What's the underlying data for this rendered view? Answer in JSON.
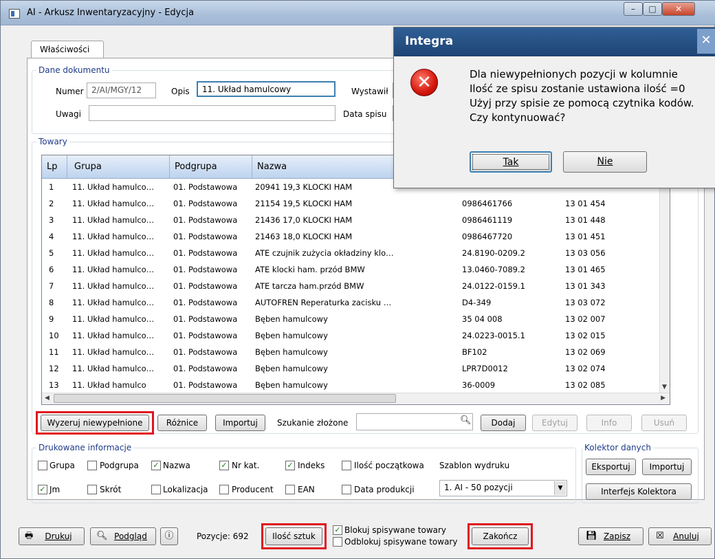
{
  "window": {
    "title": "AI - Arkusz Inwentaryzacyjny - Edycja"
  },
  "tab": "Właściwości",
  "doc": {
    "legend": "Dane dokumentu",
    "numer_label": "Numer",
    "numer": "2/AI/MGY/12",
    "opis_label": "Opis",
    "opis": "11. Układ hamulcowy",
    "wystawil_label": "Wystawił",
    "uwagi_label": "Uwagi",
    "uwagi": "",
    "data_spisu_label": "Data spisu"
  },
  "towary": {
    "legend": "Towary",
    "columns": [
      "Lp",
      "Grupa",
      "Podgrupa",
      "Nazwa"
    ],
    "rows": [
      {
        "lp": "1",
        "grupa": "11. Układ hamulco…",
        "podgrupa": "01. Podstawowa",
        "nazwa": "20941 19,3 KLOCKI HAM",
        "nr": "",
        "indeks": ""
      },
      {
        "lp": "2",
        "grupa": "11. Układ hamulco…",
        "podgrupa": "01. Podstawowa",
        "nazwa": "21154 19,5 KLOCKI HAM",
        "nr": "0986461766",
        "indeks": "13 01 454"
      },
      {
        "lp": "3",
        "grupa": "11. Układ hamulco…",
        "podgrupa": "01. Podstawowa",
        "nazwa": "21436 17,0 KLOCKI HAM",
        "nr": "0986461119",
        "indeks": "13 01 448"
      },
      {
        "lp": "4",
        "grupa": "11. Układ hamulco…",
        "podgrupa": "01. Podstawowa",
        "nazwa": "21463 18,0 KLOCKI HAM",
        "nr": "0986467720",
        "indeks": "13 01 451"
      },
      {
        "lp": "5",
        "grupa": "11. Układ hamulco…",
        "podgrupa": "01. Podstawowa",
        "nazwa": "ATE czujnik zużycia okładziny klo…",
        "nr": "24.8190-0209.2",
        "indeks": "13 03 056"
      },
      {
        "lp": "6",
        "grupa": "11. Układ hamulco…",
        "podgrupa": "01. Podstawowa",
        "nazwa": "ATE klocki ham. przód BMW",
        "nr": "13.0460-7089.2",
        "indeks": "13 01 465"
      },
      {
        "lp": "7",
        "grupa": "11. Układ hamulco…",
        "podgrupa": "01. Podstawowa",
        "nazwa": "ATE tarcza ham.przód BMW",
        "nr": "24.0122-0159.1",
        "indeks": "13 01 343"
      },
      {
        "lp": "8",
        "grupa": "11. Układ hamulco…",
        "podgrupa": "01. Podstawowa",
        "nazwa": "AUTOFREN Reperaturka zacisku …",
        "nr": "D4-349",
        "indeks": "13 03 072"
      },
      {
        "lp": "9",
        "grupa": "11. Układ hamulco…",
        "podgrupa": "01. Podstawowa",
        "nazwa": "Bęben hamulcowy",
        "nr": "35 04 008",
        "indeks": "13 02 007"
      },
      {
        "lp": "10",
        "grupa": "11. Układ hamulco…",
        "podgrupa": "01. Podstawowa",
        "nazwa": "Bęben hamulcowy",
        "nr": "24.0223-0015.1",
        "indeks": "13 02 015"
      },
      {
        "lp": "11",
        "grupa": "11. Układ hamulco…",
        "podgrupa": "01. Podstawowa",
        "nazwa": "Bęben hamulcowy",
        "nr": "BF102",
        "indeks": "13 02 069"
      },
      {
        "lp": "12",
        "grupa": "11. Układ hamulco…",
        "podgrupa": "01. Podstawowa",
        "nazwa": "Bęben hamulcowy",
        "nr": "LPR7D0012",
        "indeks": "13 02 074"
      },
      {
        "lp": "13",
        "grupa": "11. Układ hamulco",
        "podgrupa": "01. Podstawowa",
        "nazwa": "Bęben hamulcowy",
        "nr": "36-0009",
        "indeks": "13 02 085"
      }
    ]
  },
  "toolbar": {
    "wyzeruj": "Wyzeruj niewypełnione",
    "roznice": "Różnice",
    "importuj": "Importuj",
    "szukanie_label": "Szukanie złożone",
    "dodaj": "Dodaj",
    "edytuj": "Edytuj",
    "info": "Info",
    "usun": "Usuń"
  },
  "print": {
    "legend": "Drukowane informacje",
    "grupa": "Grupa",
    "podgrupa": "Podgrupa",
    "nazwa": "Nazwa",
    "nrkat": "Nr kat.",
    "indeks": "Indeks",
    "ilosc_pocz": "Ilość początkowa",
    "jm": "Jm",
    "skrot": "Skrót",
    "lokalizacja": "Lokalizacja",
    "producent": "Producent",
    "ean": "EAN",
    "data_prod": "Data produkcji",
    "szablon_label": "Szablon wydruku",
    "szablon": "1. AI - 50 pozycji"
  },
  "kolektor": {
    "legend": "Kolektor danych",
    "eksportuj": "Eksportuj",
    "importuj": "Importuj",
    "interfejs": "Interfejs Kolektora"
  },
  "bottom": {
    "drukuj": "Drukuj",
    "podglad": "Podgląd",
    "pozycje": "Pozycje: 692",
    "ilosc_sztuk": "Ilość sztuk",
    "blokuj": "Blokuj spisywane towary",
    "odblokuj": "Odblokuj spisywane towary",
    "zakoncz": "Zakończ",
    "zapisz": "Zapisz",
    "anuluj": "Anuluj"
  },
  "dialog": {
    "title": "Integra",
    "message": "Dla niewypełnionych pozycji w kolumnie\nIlość  ze spisu zostanie ustawiona ilość =0\nUżyj przy spisie ze pomocą czytnika kodów.\nCzy kontynuować?",
    "tak": "Tak",
    "nie": "Nie"
  }
}
